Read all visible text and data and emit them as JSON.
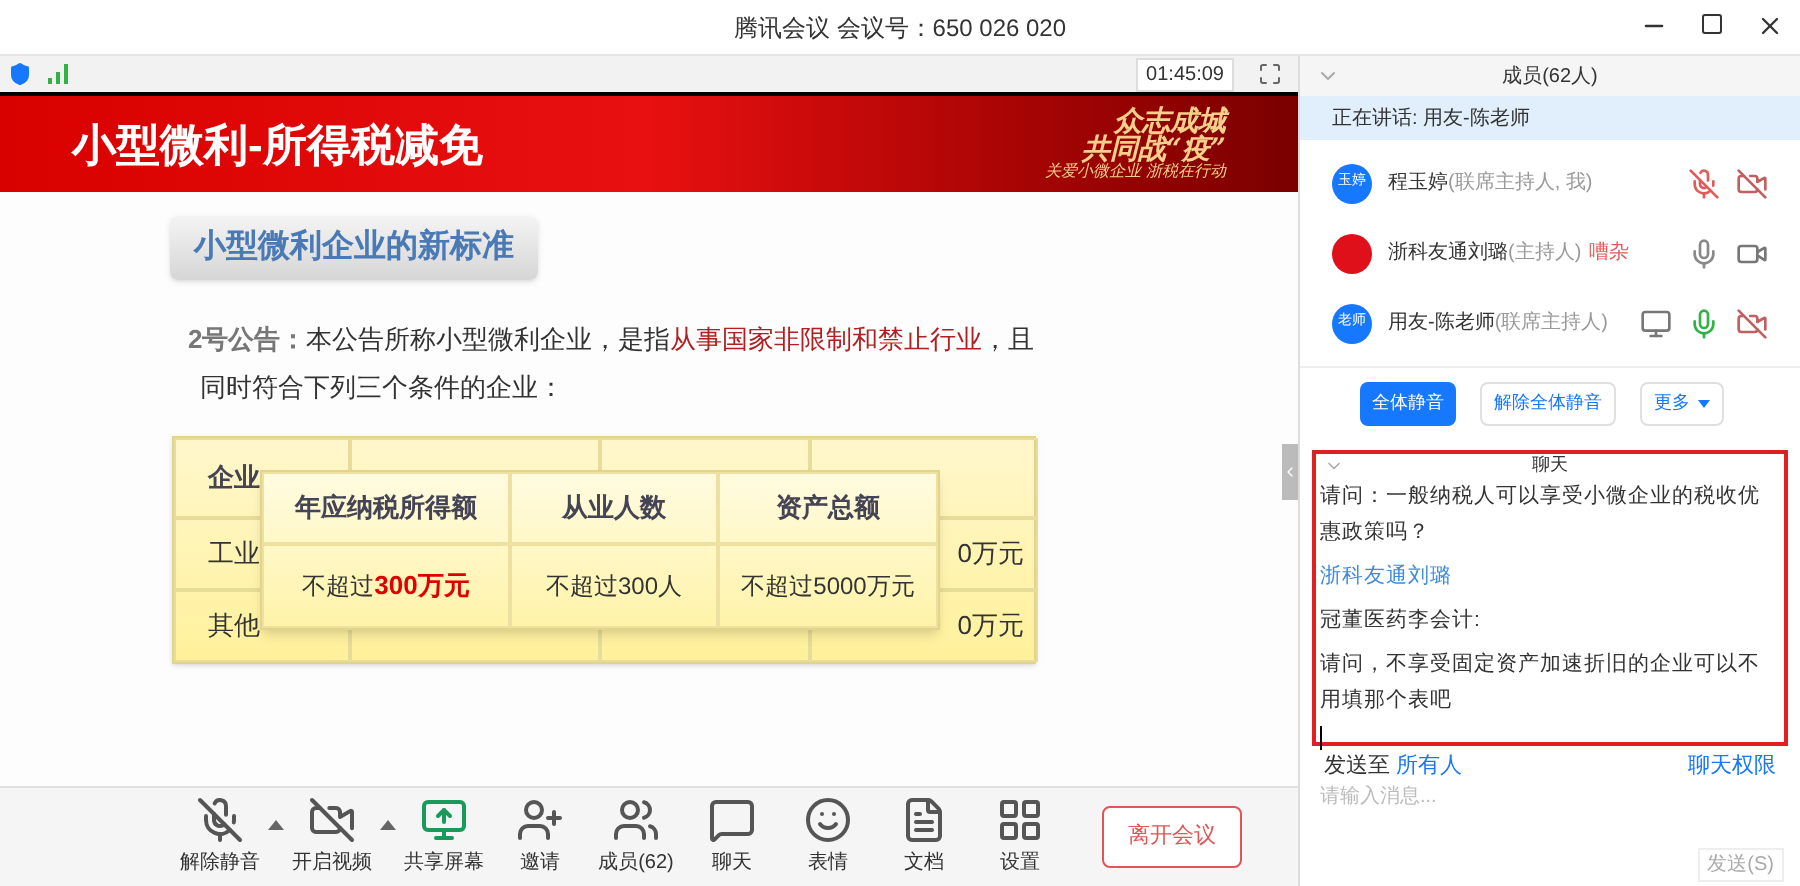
{
  "window": {
    "title": "腾讯会议 会议号：650 026 020"
  },
  "video_bar": {
    "timer": "01:45:09"
  },
  "slide": {
    "banner_title": "小型微利-所得税减免",
    "banner_slogan_1": "众志成城",
    "banner_slogan_2": "共同战“疫”",
    "banner_slogan_3": "关爱小微企业 浙税在行动",
    "subtitle": "小型微利企业的**新标准**",
    "paragraph": [
      {
        "kind": "label",
        "text": "2号公告："
      },
      {
        "kind": "plain",
        "text": "本公告所称小型微利企业，是指"
      },
      {
        "kind": "highlight",
        "text": "从事国家非限制和禁止行业"
      },
      {
        "kind": "plain",
        "text": "，且"
      }
    ],
    "paragraph_line_2": "同时符合下列三个条件的企业：",
    "back_table": {
      "header": "企业",
      "rows": [
        {
          "first": "工业",
          "last": "0万元"
        },
        {
          "first": "其他",
          "last": "0万元"
        }
      ]
    },
    "front_table": {
      "columns": [
        "年应纳税所得额",
        "从业人数",
        "资产总额"
      ],
      "row": [
        {
          "prefix": "不超过",
          "highlight": "300万元"
        },
        {
          "prefix": "不超过300人"
        },
        {
          "prefix": "不超过5000万元"
        }
      ]
    }
  },
  "toolbar": [
    {
      "label": "解除静音",
      "caret": true
    },
    {
      "label": "开启视频",
      "caret": true
    },
    {
      "label": "共享屏幕",
      "caret": false
    },
    {
      "label": "邀请",
      "caret": false
    },
    {
      "label": "成员(62)",
      "caret": false
    },
    {
      "label": "聊天",
      "caret": false
    },
    {
      "label": "表情",
      "caret": false
    },
    {
      "label": "文档",
      "caret": false
    },
    {
      "label": "设置",
      "caret": false
    }
  ],
  "leave_button": "离开会议",
  "members_panel": {
    "title": "成员(62人)",
    "speaking": "正在讲话: 用友-陈老师",
    "members": [
      {
        "avatar": "玉婷",
        "color": "#1677ff",
        "name": "程玉婷",
        "role": "(联席主持人, 我)",
        "muted": true,
        "speaking": false,
        "video": false,
        "sharing": false
      },
      {
        "color": "#e0101a",
        "name": "浙科友通刘璐",
        "role": "(主持人)",
        "tag": "嘈杂",
        "muted": false,
        "speaking": false,
        "video": true,
        "sharing": false
      },
      {
        "avatar": "老师",
        "color": "#1677ff",
        "name": "用友-陈老师",
        "role": "(联席主持人)",
        "muted": false,
        "speaking": true,
        "video": false,
        "sharing": true
      }
    ],
    "buttons": [
      {
        "label": "全体静音",
        "primary": true,
        "caret": false
      },
      {
        "label": "解除全体静音",
        "primary": false,
        "caret": false
      },
      {
        "label": "更多",
        "primary": false,
        "caret": true
      }
    ]
  },
  "chat": {
    "title": "聊天",
    "messages": [
      {
        "kind": "text",
        "text": "请问：一般纳税人可以享受小微企业的税收优惠政策吗？"
      },
      {
        "kind": "sender",
        "text": "浙科友通刘璐"
      },
      {
        "kind": "plain",
        "text": "冠董医药李会计:"
      },
      {
        "kind": "text",
        "text": "请问，不享受固定资产加速折旧的企业可以不用填那个表吧"
      }
    ],
    "send_to_label": "发送至",
    "send_to": "所有人",
    "permission": "聊天权限",
    "placeholder": "请输入消息...",
    "send": "发送(S)"
  }
}
